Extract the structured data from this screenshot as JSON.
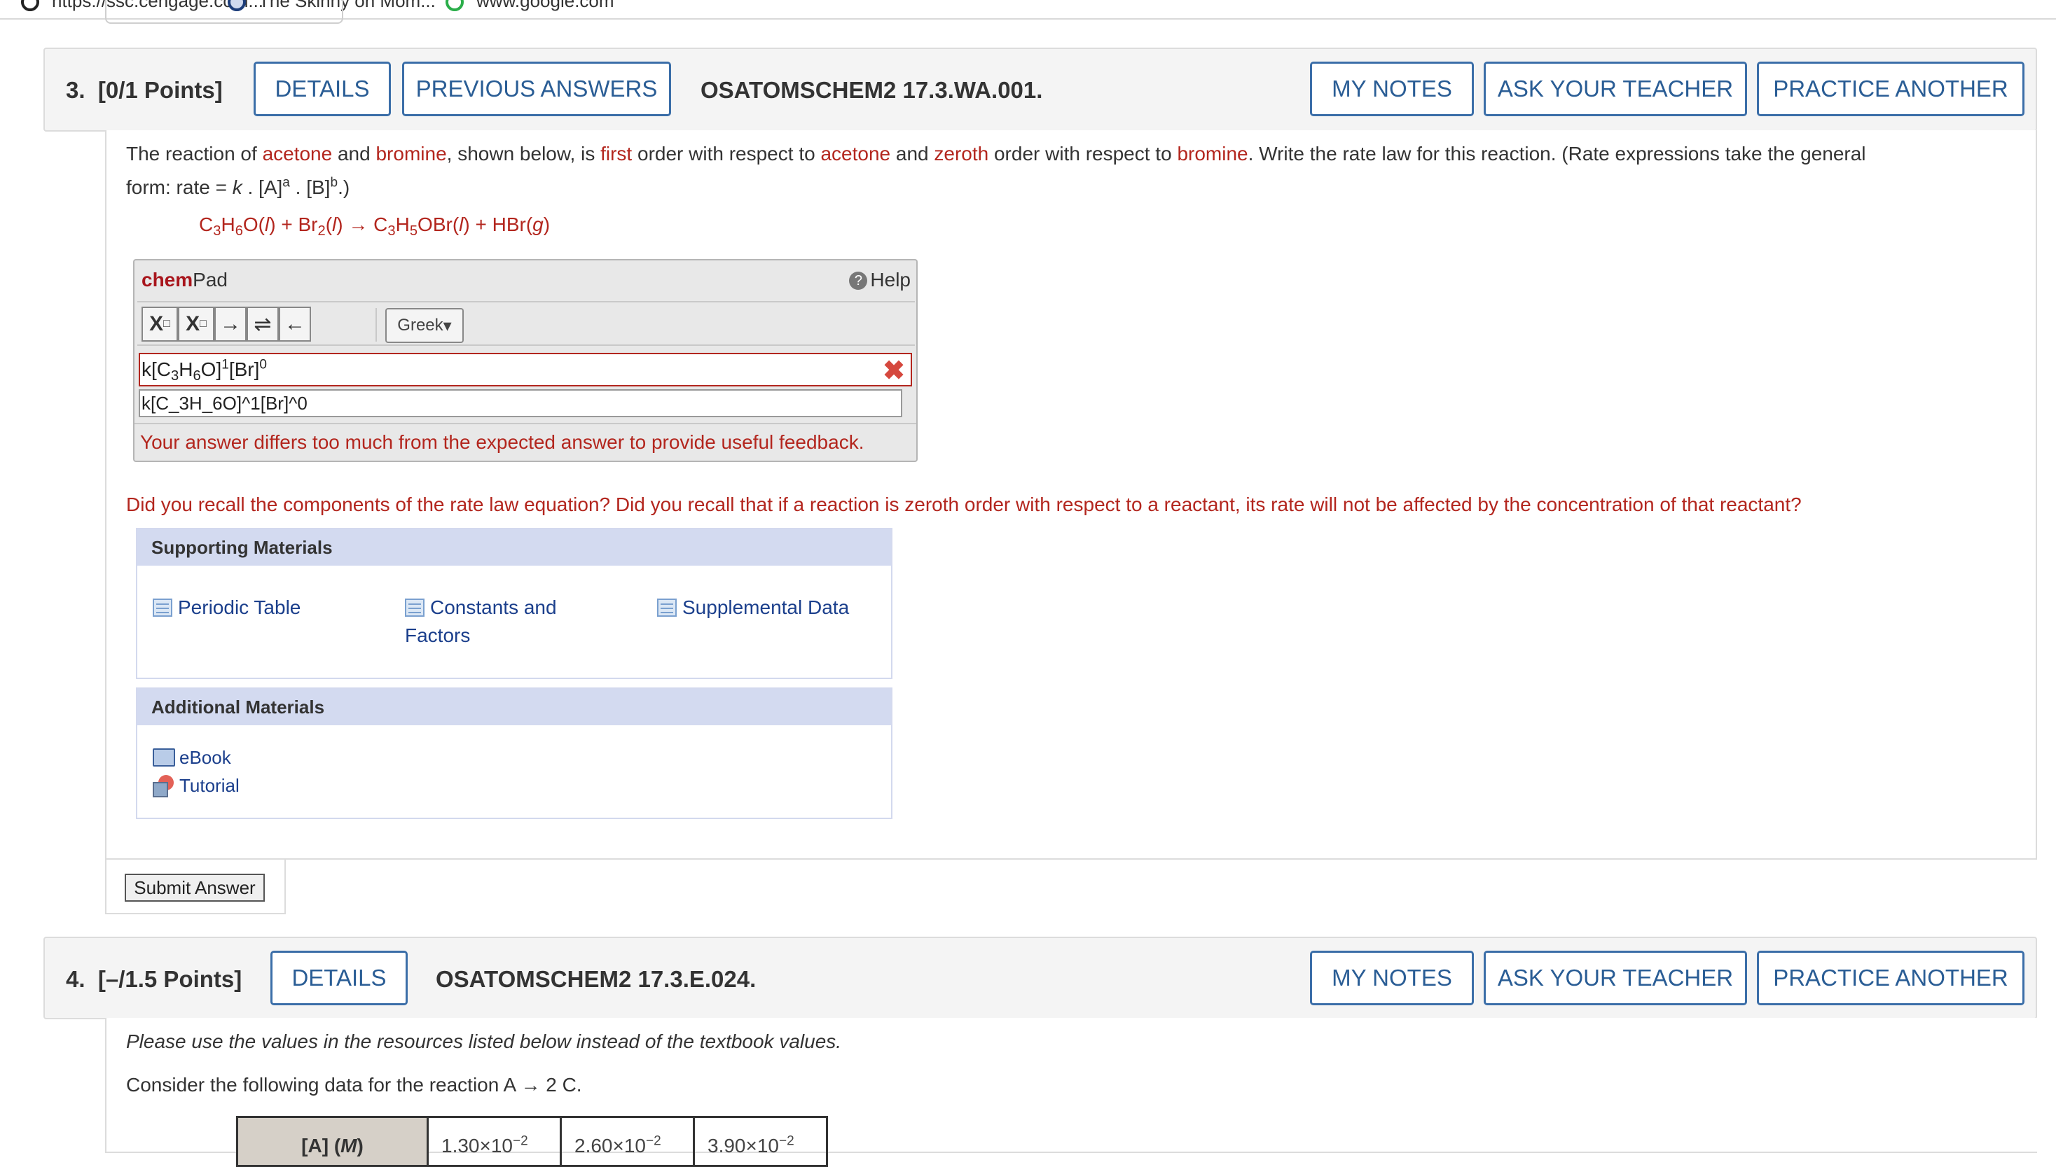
{
  "bookmarks": {
    "items": [
      "https://ssc.cengage.com...",
      "The Skinny on Mom...",
      "www.google.com"
    ]
  },
  "q3": {
    "number": "3.",
    "points": "[0/1 Points]",
    "details": "DETAILS",
    "previous_answers": "PREVIOUS ANSWERS",
    "code": "OSATOMSCHEM2 17.3.WA.001.",
    "my_notes": "MY NOTES",
    "ask_teacher": "ASK YOUR TEACHER",
    "practice_another": "PRACTICE ANOTHER",
    "prompt": {
      "p1": "The reaction of ",
      "w_acetone1": "acetone",
      "p2": " and ",
      "w_bromine1": "bromine",
      "p3": ", shown below, is ",
      "w_first": "first",
      "p4": " order with respect to ",
      "w_acetone2": "acetone",
      "p5": " and ",
      "w_zeroth": "zeroth",
      "p6": " order with respect to ",
      "w_bromine2": "bromine",
      "p7": ". Write the rate law for this reaction. (Rate expressions take the general",
      "line2_a": "form: rate = ",
      "line2_k": "k",
      "line2_b": " . [A]",
      "line2_a_exp": "a",
      "line2_c": " . [B]",
      "line2_b_exp": "b",
      "line2_d": ".)"
    },
    "equation": {
      "c": "C",
      "c_sub": "3",
      "h": "H",
      "h_sub": "6",
      "o_l": "O(",
      "l1": "l",
      "plus1": ") + Br",
      "br_sub": "2",
      "l2_open": "(",
      "l2": "l",
      "arrow": ") → C",
      "c2_sub": "3",
      "h2": "H",
      "h2_sub": "5",
      "obr": "OBr(",
      "l3": "l",
      "hbr": ") + HBr(",
      "g": "g",
      "close": ")"
    },
    "chempad": {
      "brand_bold": "chem",
      "brand_rest": "Pad",
      "help": "Help",
      "help_icon": "?",
      "toolbar": {
        "subscript": "X",
        "subscript_mark": "□",
        "superscript": "X",
        "superscript_mark": "□",
        "arrow_right": "→",
        "equilibrium": "⇌",
        "arrow_left": "←"
      },
      "greek": "Greek",
      "greek_caret": "▾",
      "answer": {
        "k": "k[C",
        "s1": "3",
        "h": "H",
        "s2": "6",
        "o": "O]",
        "e1": "1",
        "br": "[Br]",
        "e2": "0"
      },
      "answer_error_mark": "✖",
      "raw_answer": "k[C_3H_6O]^1[Br]^0",
      "feedback": "Your answer differs too much from the expected answer to provide useful feedback."
    },
    "hint": "Did you recall the components of the rate law equation? Did you recall that if a reaction is zeroth order with respect to a reactant, its rate will not be affected by the concentration of that reactant?",
    "supporting": {
      "title": "Supporting Materials",
      "periodic_table": "Periodic Table",
      "constants_1": "Constants and",
      "constants_2": "Factors",
      "supplemental": "Supplemental Data"
    },
    "additional": {
      "title": "Additional Materials",
      "ebook": "eBook",
      "tutorial": "Tutorial"
    },
    "submit": "Submit Answer"
  },
  "q4": {
    "number": "4.",
    "points": "[–/1.5 Points]",
    "details": "DETAILS",
    "code": "OSATOMSCHEM2 17.3.E.024.",
    "my_notes": "MY NOTES",
    "ask_teacher": "ASK YOUR TEACHER",
    "practice_another": "PRACTICE ANOTHER",
    "note": "Please use the values in the resources listed below instead of the textbook values.",
    "consider": "Consider the following data for the reaction A → 2 C.",
    "table": {
      "header_a": "[A] (",
      "header_m": "M",
      "header_close": ")",
      "values": [
        {
          "mant": "1.30×10",
          "exp": "−2"
        },
        {
          "mant": "2.60×10",
          "exp": "−2"
        },
        {
          "mant": "3.90×10",
          "exp": "−2"
        }
      ]
    }
  }
}
